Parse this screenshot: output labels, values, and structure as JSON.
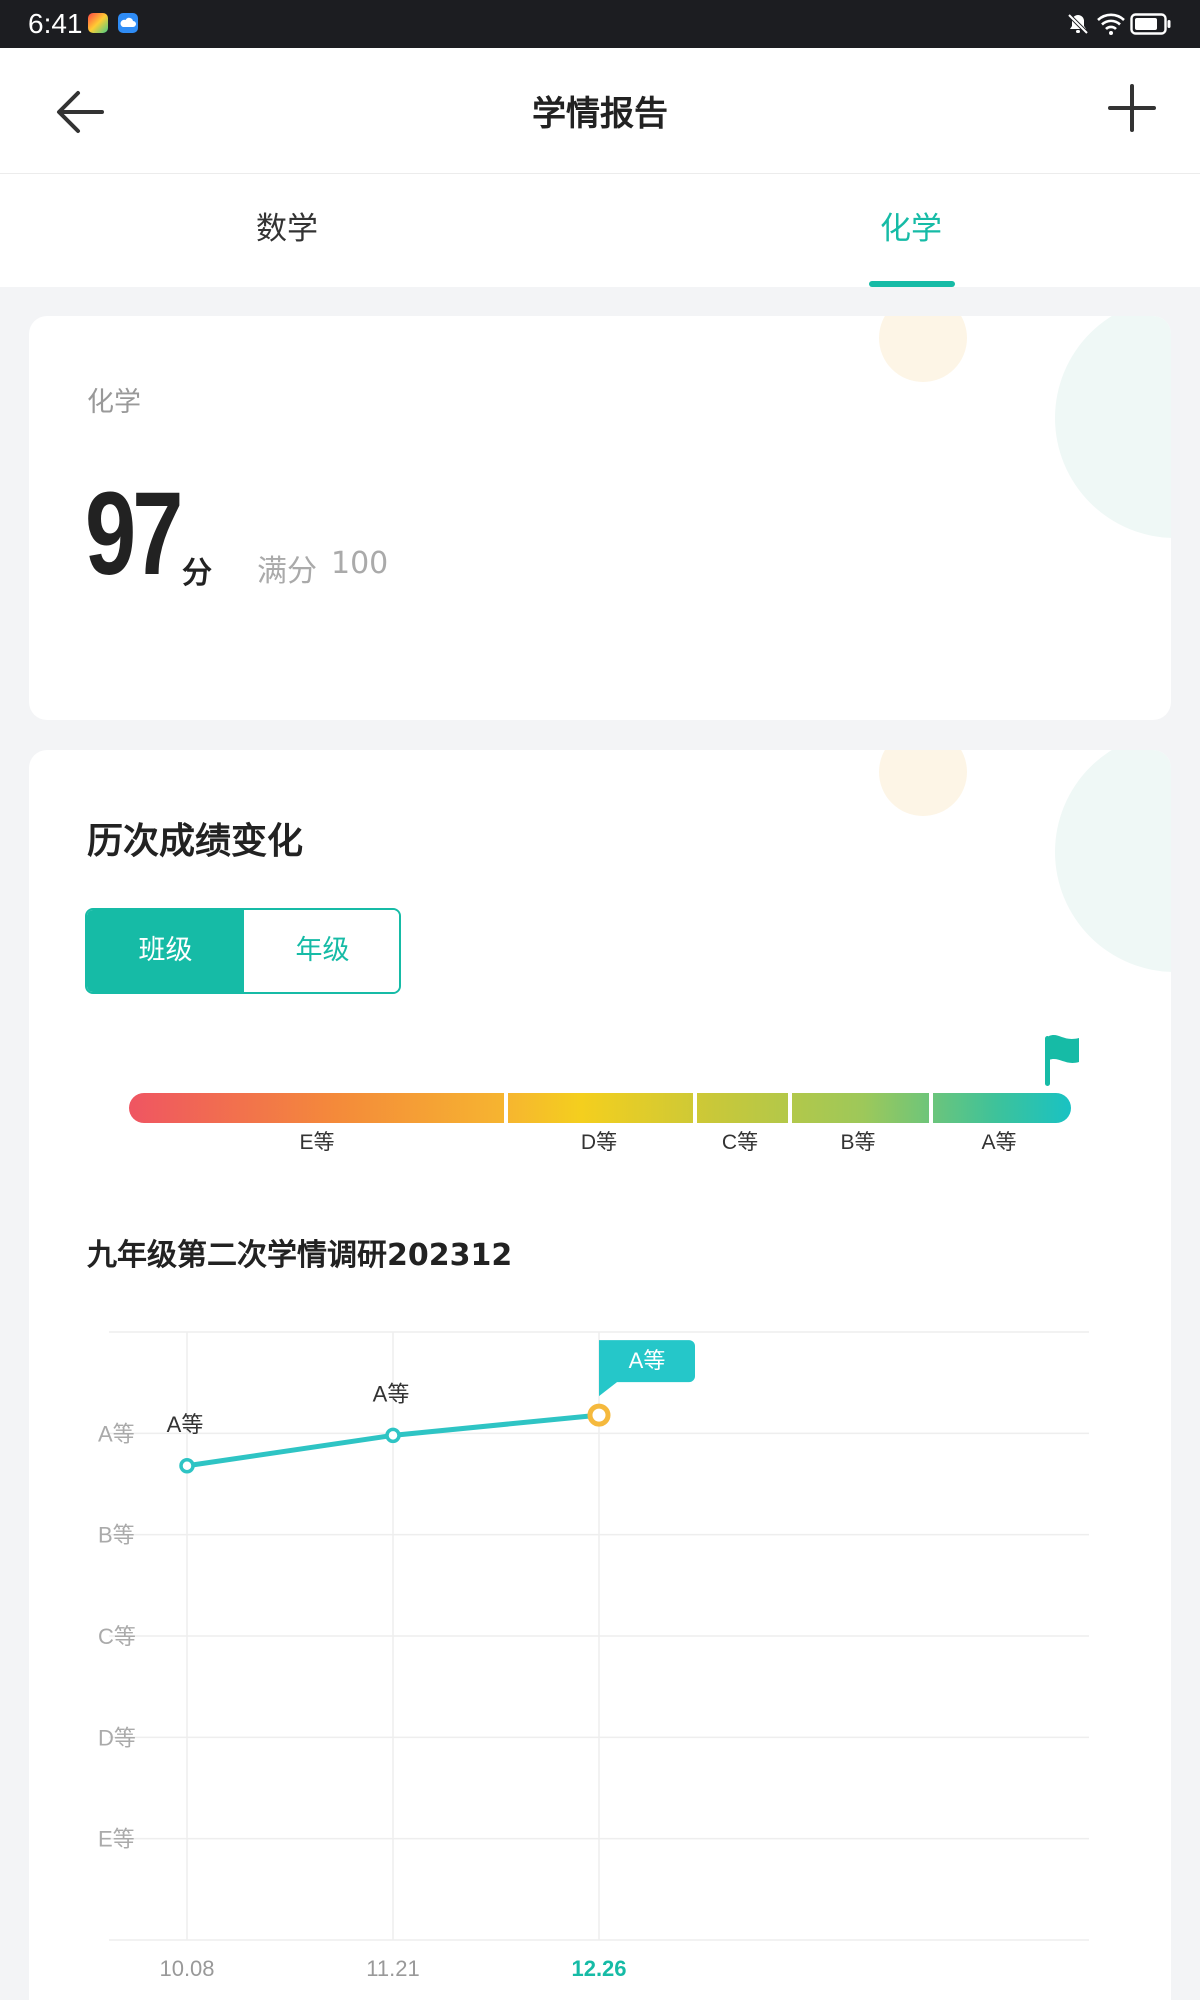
{
  "status_bar": {
    "time": "6:41"
  },
  "header": {
    "title": "学情报告"
  },
  "tabs": [
    {
      "label": "数学",
      "active": false
    },
    {
      "label": "化学",
      "active": true
    }
  ],
  "score_card": {
    "subject": "化学",
    "score": "97",
    "unit": "分",
    "full_label": "满分",
    "full_value": "100"
  },
  "history": {
    "title": "历次成绩变化",
    "toggle": {
      "class_label": "班级",
      "grade_label": "年级",
      "selected": "班级"
    },
    "grade_bar": {
      "labels": [
        "E等",
        "D等",
        "C等",
        "B等",
        "A等"
      ],
      "current": "A等"
    },
    "exam_title": "九年级第二次学情调研202312"
  },
  "colors": {
    "accent": "#16bba6",
    "line": "#2ec4c4",
    "highlight_point": "#f5b93d"
  },
  "chart_data": {
    "type": "line",
    "x": [
      "10.08",
      "11.21",
      "12.26"
    ],
    "y_categories": [
      "E等",
      "D等",
      "C等",
      "B等",
      "A等"
    ],
    "series": [
      {
        "values": [
          4.68,
          4.98,
          5.18
        ],
        "point_labels": [
          "A等",
          "A等",
          "A等"
        ]
      }
    ],
    "highlighted_index": 2,
    "grid": true,
    "ylim": [
      0,
      6
    ]
  }
}
